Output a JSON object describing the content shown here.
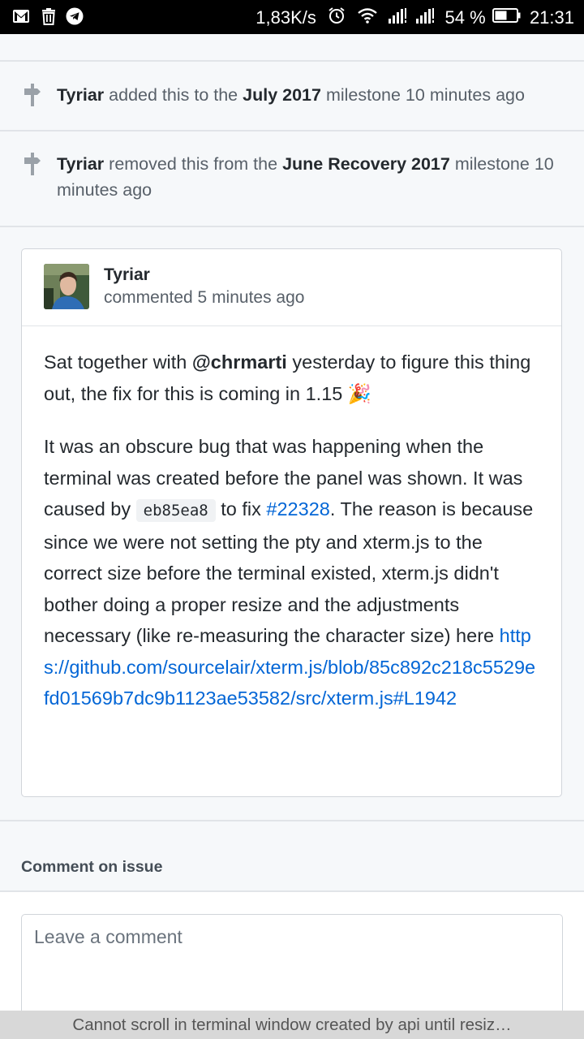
{
  "status_bar": {
    "left_icons": [
      "gmail-icon",
      "trash-icon",
      "telegram-icon"
    ],
    "speed": "1,83K/s",
    "battery": "54 %",
    "time": "21:31"
  },
  "events": [
    {
      "actor": "Tyriar",
      "action": "added this to the",
      "milestone": "July 2017",
      "suffix": "milestone 10 minutes ago"
    },
    {
      "actor": "Tyriar",
      "action": "removed this from the",
      "milestone": "June Recovery 2017",
      "suffix": "milestone 10 minutes ago"
    }
  ],
  "comment": {
    "author": "Tyriar",
    "meta": "commented 5 minutes ago",
    "p1_before": "Sat together with ",
    "p1_mention": "@chrmarti",
    "p1_after": " yesterday to figure this thing out, the fix for this is coming in 1.15 ",
    "p1_emoji": "🎉",
    "p2_a": "It was an obscure bug that was happening when the terminal was created before the panel was shown. It was caused by ",
    "p2_commit": "eb85ea8",
    "p2_b": " to fix ",
    "p2_issue": "#22328",
    "p2_c": ". The reason is because since we were not setting the pty and xterm.js to the correct size before the terminal existed, xterm.js didn't bother doing a proper resize and the adjustments necessary (like re-measuring the character size) here ",
    "p2_url": "https://github.com/sourcelair/xterm.js/blob/85c892c218c5529efd01569b7dc9b1123ae53582/src/xterm.js#L1942"
  },
  "comment_section": {
    "title": "Comment on issue",
    "placeholder": "Leave a comment"
  },
  "bottom_bar": {
    "title": "Cannot scroll in terminal window created by api until resiz…"
  },
  "colors": {
    "link": "#0366d6",
    "muted": "#586069",
    "background": "#f6f8fa"
  }
}
